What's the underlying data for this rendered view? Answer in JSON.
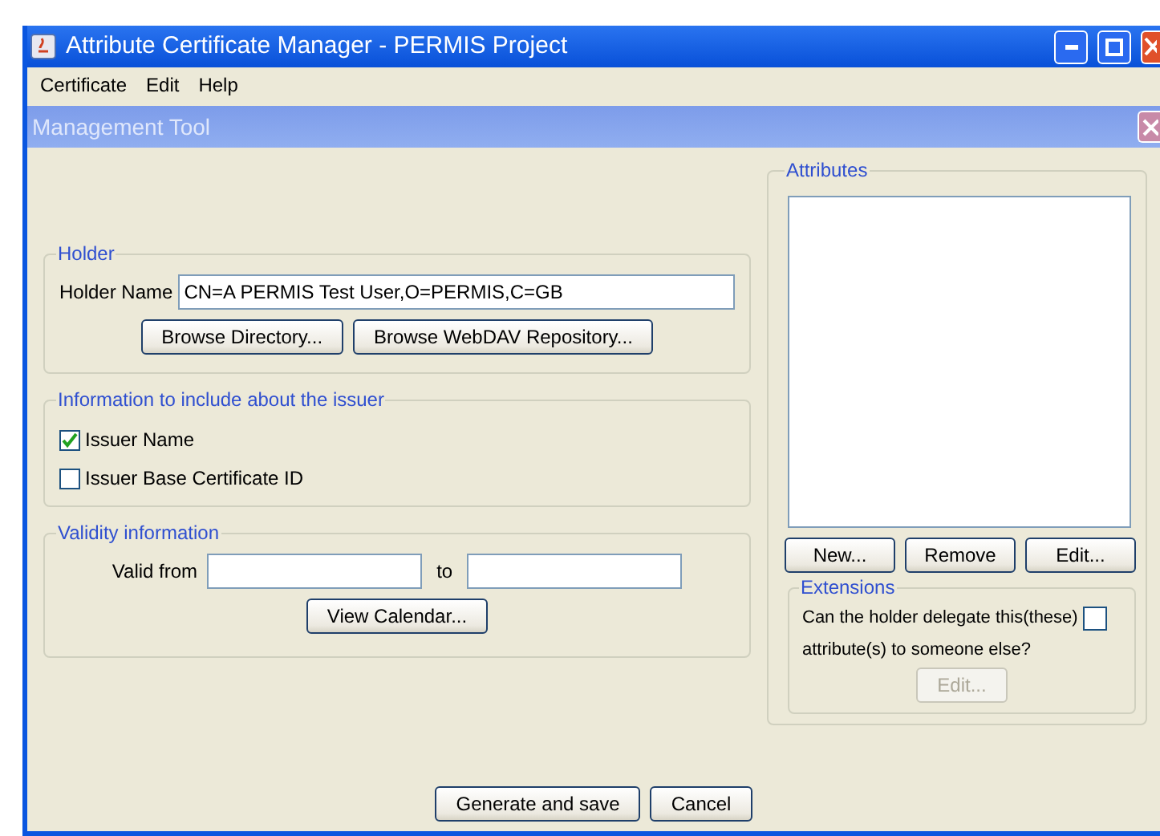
{
  "window": {
    "title": "Attribute Certificate Manager - PERMIS Project"
  },
  "menu": [
    "Certificate",
    "Edit",
    "Help"
  ],
  "internal_frame": {
    "title": "Management Tool"
  },
  "holder": {
    "legend": "Holder",
    "label": "Holder Name",
    "value": "CN=A PERMIS Test User,O=PERMIS,C=GB",
    "buttons": [
      "Browse Directory...",
      "Browse WebDAV Repository..."
    ]
  },
  "issuer_info": {
    "legend": "Information to include about the issuer",
    "options": [
      {
        "label": "Issuer Name",
        "checked": true
      },
      {
        "label": "Issuer Base Certificate ID",
        "checked": false
      }
    ]
  },
  "validity": {
    "legend": "Validity information",
    "from_label": "Valid from",
    "to_label": "to",
    "button": "View Calendar..."
  },
  "attributes": {
    "legend": "Attributes",
    "buttons": [
      "New...",
      "Remove",
      "Edit..."
    ]
  },
  "extensions": {
    "legend": "Extensions",
    "question_lines": [
      "Can the holder delegate this(these)",
      "attribute(s) to someone else?"
    ],
    "checked": false,
    "button": {
      "label": "Edit...",
      "disabled": true
    }
  },
  "footer_buttons": [
    "Generate and save",
    "Cancel"
  ]
}
